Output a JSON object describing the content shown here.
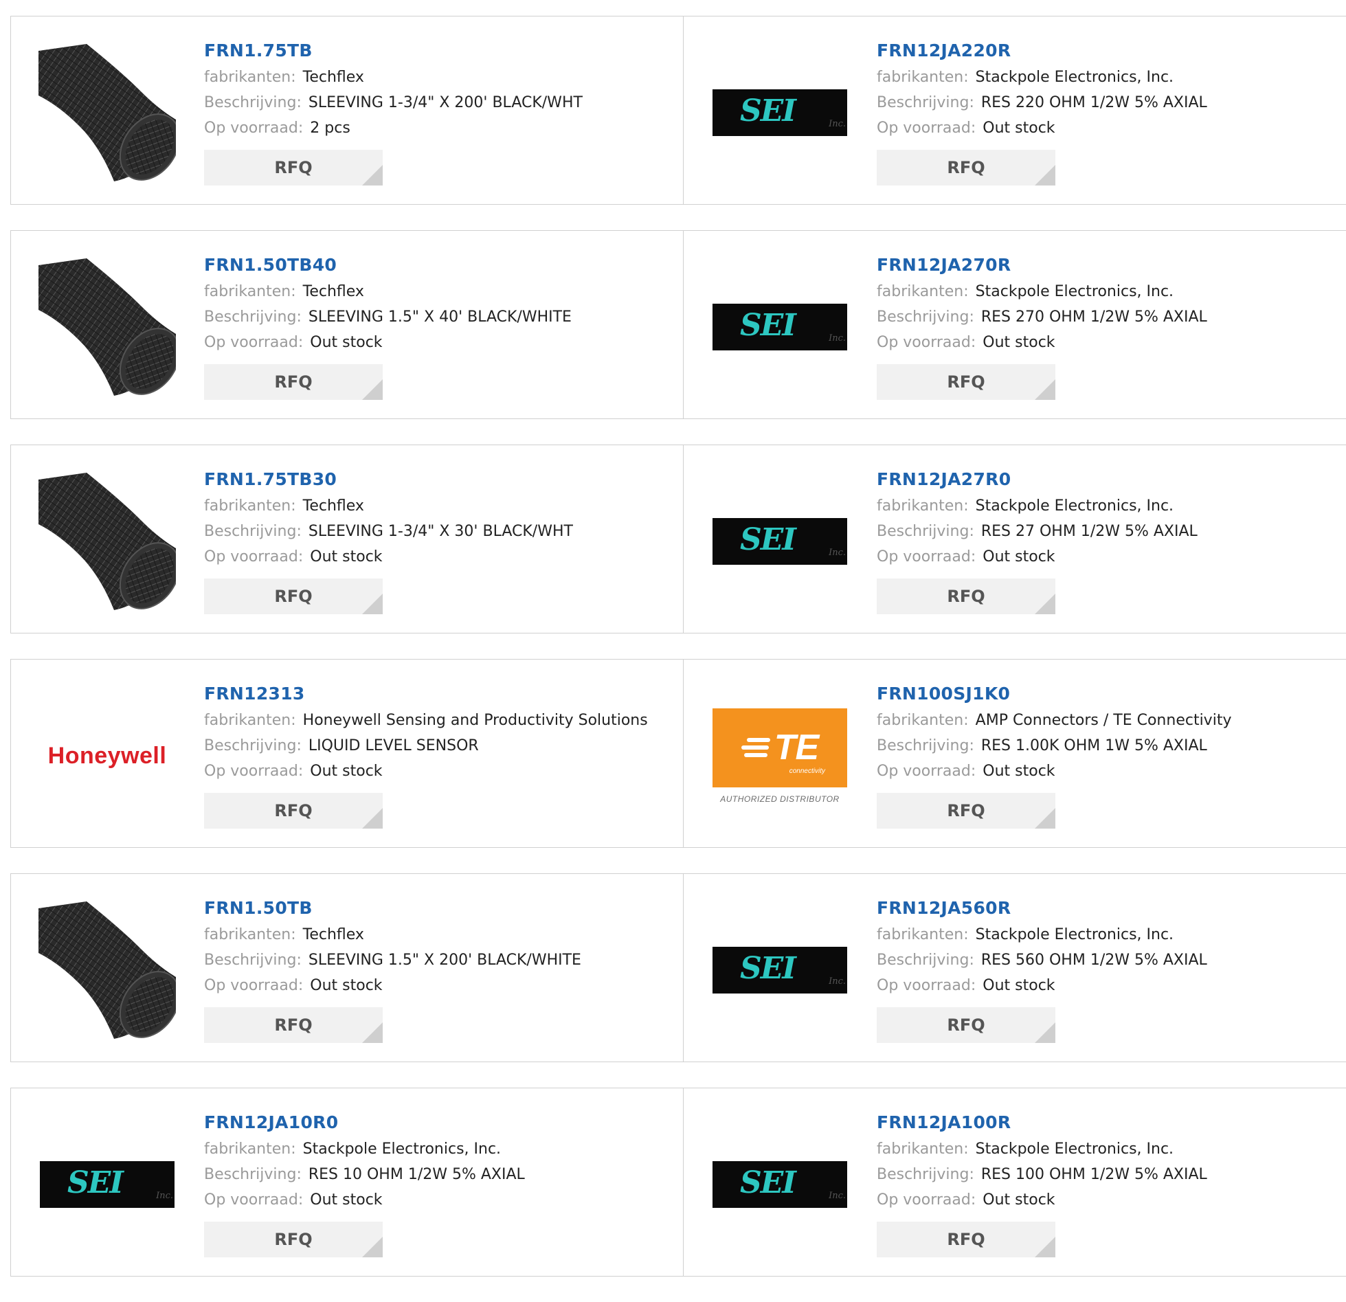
{
  "labels": {
    "manufacturer": "fabrikanten:",
    "description": "Beschrijving:",
    "stock": "Op voorraad:",
    "rfq": "RFQ"
  },
  "logos": {
    "sei_text": "SEI",
    "sei_inc": "Inc.",
    "honeywell": "Honeywell",
    "te_text": "TE",
    "te_sub": "connectivity",
    "te_dist": "AUTHORIZED DISTRIBUTOR"
  },
  "colors": {
    "link": "#1f63ad",
    "label": "#9a9a9a",
    "rfq_bg": "#f1f1f1",
    "border": "#d0d0d0"
  },
  "products": [
    {
      "part": "FRN1.75TB",
      "manufacturer": "Techflex",
      "description": "SLEEVING 1-3/4\" X 200' BLACK/WHT",
      "stock": "2 pcs",
      "image": "sleeving"
    },
    {
      "part": "FRN12JA220R",
      "manufacturer": "Stackpole Electronics, Inc.",
      "description": "RES 220 OHM 1/2W 5% AXIAL",
      "stock": "Out stock",
      "image": "sei"
    },
    {
      "part": "FRN1.50TB40",
      "manufacturer": "Techflex",
      "description": "SLEEVING 1.5\" X 40' BLACK/WHITE",
      "stock": "Out stock",
      "image": "sleeving"
    },
    {
      "part": "FRN12JA270R",
      "manufacturer": "Stackpole Electronics, Inc.",
      "description": "RES 270 OHM 1/2W 5% AXIAL",
      "stock": "Out stock",
      "image": "sei"
    },
    {
      "part": "FRN1.75TB30",
      "manufacturer": "Techflex",
      "description": "SLEEVING 1-3/4\" X 30' BLACK/WHT",
      "stock": "Out stock",
      "image": "sleeving"
    },
    {
      "part": "FRN12JA27R0",
      "manufacturer": "Stackpole Electronics, Inc.",
      "description": "RES 27 OHM 1/2W 5% AXIAL",
      "stock": "Out stock",
      "image": "sei"
    },
    {
      "part": "FRN12313",
      "manufacturer": "Honeywell Sensing and Productivity Solutions",
      "description": "LIQUID LEVEL SENSOR",
      "stock": "Out stock",
      "image": "honeywell"
    },
    {
      "part": "FRN100SJ1K0",
      "manufacturer": "AMP Connectors / TE Connectivity",
      "description": "RES 1.00K OHM 1W 5% AXIAL",
      "stock": "Out stock",
      "image": "te"
    },
    {
      "part": "FRN1.50TB",
      "manufacturer": "Techflex",
      "description": "SLEEVING 1.5\" X 200' BLACK/WHITE",
      "stock": "Out stock",
      "image": "sleeving"
    },
    {
      "part": "FRN12JA560R",
      "manufacturer": "Stackpole Electronics, Inc.",
      "description": "RES 560 OHM 1/2W 5% AXIAL",
      "stock": "Out stock",
      "image": "sei"
    },
    {
      "part": "FRN12JA10R0",
      "manufacturer": "Stackpole Electronics, Inc.",
      "description": "RES 10 OHM 1/2W 5% AXIAL",
      "stock": "Out stock",
      "image": "sei"
    },
    {
      "part": "FRN12JA100R",
      "manufacturer": "Stackpole Electronics, Inc.",
      "description": "RES 100 OHM 1/2W 5% AXIAL",
      "stock": "Out stock",
      "image": "sei"
    }
  ]
}
